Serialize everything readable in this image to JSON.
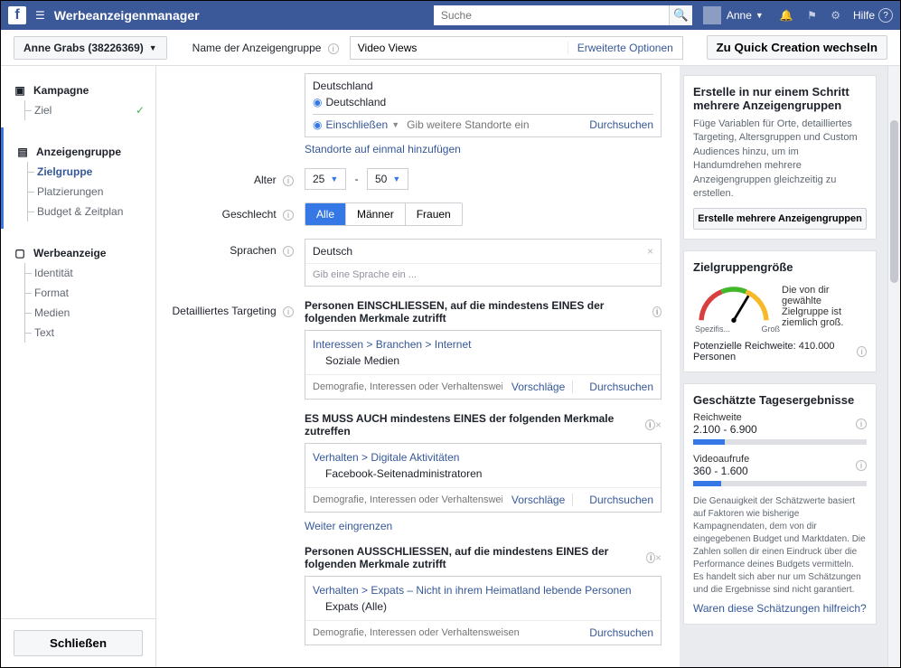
{
  "topbar": {
    "title": "Werbeanzeigenmanager",
    "search_placeholder": "Suche",
    "user": "Anne",
    "help": "Hilfe"
  },
  "subbar": {
    "account": "Anne Grabs (38226369)",
    "name_label": "Name der Anzeigengruppe",
    "name_value": "Video Views",
    "advanced": "Erweiterte Optionen",
    "quick": "Zu Quick Creation wechseln"
  },
  "nav": {
    "campaign": "Kampagne",
    "campaign_items": [
      "Ziel"
    ],
    "adset": "Anzeigengruppe",
    "adset_items": [
      "Zielgruppe",
      "Platzierungen",
      "Budget & Zeitplan"
    ],
    "ad": "Werbeanzeige",
    "ad_items": [
      "Identität",
      "Format",
      "Medien",
      "Text"
    ],
    "close": "Schließen"
  },
  "loc": {
    "heading": "Deutschland",
    "value": "Deutschland",
    "include": "Einschließen",
    "placeholder": "Gib weitere Standorte ein",
    "browse": "Durchsuchen",
    "addlink": "Standorte auf einmal hinzufügen"
  },
  "age": {
    "label": "Alter",
    "min": "25",
    "max": "50"
  },
  "gender": {
    "label": "Geschlecht",
    "all": "Alle",
    "m": "Männer",
    "f": "Frauen"
  },
  "lang": {
    "label": "Sprachen",
    "value": "Deutsch",
    "placeholder": "Gib eine Sprache ein ..."
  },
  "det": {
    "label": "Detailliertes Targeting",
    "include_head": "Personen EINSCHLIESSEN, auf die mindestens EINES der folgenden Merkmale zutrifft",
    "crumb1": "Interessen > Branchen > Internet",
    "val1": "Soziale Medien",
    "input_ph": "Demografie, Interessen oder Verhaltenswei...",
    "input_ph_full": "Demografie, Interessen oder Verhaltensweisen",
    "suggest": "Vorschläge",
    "browse": "Durchsuchen",
    "also_head": "ES MUSS AUCH mindestens EINES der folgenden Merkmale zutreffen",
    "crumb2": "Verhalten > Digitale Aktivitäten",
    "val2": "Facebook-Seitenadministratoren",
    "narrow": "Weiter eingrenzen",
    "exclude_head": "Personen AUSSCHLIESSEN, auf die mindestens EINES der folgenden Merkmale zutrifft",
    "crumb3": "Verhalten > Expats – Nicht in ihrem Heimatland lebende Personen",
    "val3": "Expats (Alle)"
  },
  "right": {
    "box1_head": "Erstelle in nur einem Schritt mehrere Anzeigengruppen",
    "box1_body": "Füge Variablen für Orte, detailliertes Targeting, Altersgruppen und Custom Audiences hinzu, um im Handumdrehen mehrere Anzeigengruppen gleichzeitig zu erstellen.",
    "box1_btn": "Erstelle mehrere Anzeigengruppen",
    "box2_head": "Zielgruppengröße",
    "gauge_left": "Spezifis...",
    "gauge_right": "Groß",
    "gauge_text": "Die von dir gewählte Zielgruppe ist ziemlich groß.",
    "reach": "Potenzielle Reichweite: 410.000 Personen",
    "box3_head": "Geschätzte Tagesergebnisse",
    "reach_label": "Reichweite",
    "reach_val": "2.100 - 6.900",
    "views_label": "Videoaufrufe",
    "views_val": "360 - 1.600",
    "disclaimer": "Die Genauigkeit der Schätzwerte basiert auf Faktoren wie bisherige Kampagnendaten, dem von dir eingegebenen Budget und Marktdaten. Die Zahlen sollen dir einen Eindruck über die Performance deines Budgets vermitteln. Es handelt sich aber nur um Schätzungen und die Ergebnisse sind nicht garantiert.",
    "feedback": "Waren diese Schätzungen hilfreich?"
  }
}
